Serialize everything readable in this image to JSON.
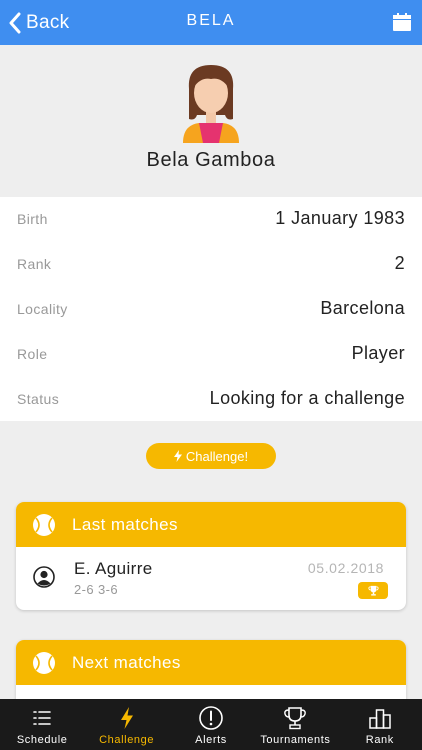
{
  "header": {
    "back_label": "Back",
    "title": "BELA"
  },
  "profile": {
    "name": "Bela Gamboa"
  },
  "details": [
    {
      "label": "Birth",
      "value": "1 January 1983"
    },
    {
      "label": "Rank",
      "value": "2"
    },
    {
      "label": "Locality",
      "value": "Barcelona"
    },
    {
      "label": "Role",
      "value": "Player"
    },
    {
      "label": "Status",
      "value": "Looking for a challenge"
    }
  ],
  "challenge_button": {
    "label": "Challenge!"
  },
  "last_matches": {
    "title": "Last matches",
    "items": [
      {
        "opponent": "E. Aguirre",
        "score": "2-6 3-6",
        "date": "05.02.2018"
      }
    ]
  },
  "next_matches": {
    "title": "Next matches"
  },
  "tabs": [
    {
      "label": "Schedule",
      "icon": "list-icon",
      "active": false
    },
    {
      "label": "Challenge",
      "icon": "lightning-icon",
      "active": true
    },
    {
      "label": "Alerts",
      "icon": "alert-icon",
      "active": false
    },
    {
      "label": "Tournaments",
      "icon": "trophy-icon",
      "active": false
    },
    {
      "label": "Rank",
      "icon": "podium-icon",
      "active": false
    }
  ],
  "colors": {
    "primary": "#3f8ef0",
    "accent": "#f6b800",
    "tabbar": "#1a1a1a"
  }
}
